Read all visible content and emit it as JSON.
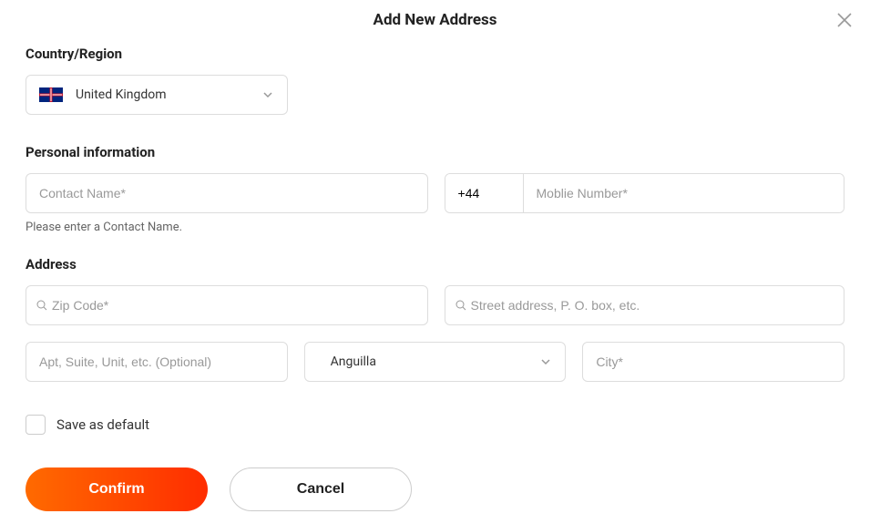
{
  "modal": {
    "title": "Add New Address"
  },
  "country": {
    "section_label": "Country/Region",
    "selected": "United Kingdom"
  },
  "personal": {
    "section_label": "Personal information",
    "contact_placeholder": "Contact Name*",
    "phone_code": "+44",
    "mobile_placeholder": "Moblie Number*",
    "helper": "Please enter a Contact Name."
  },
  "address": {
    "section_label": "Address",
    "zip_placeholder": "Zip Code*",
    "street_placeholder": "Street address, P. O. box, etc.",
    "apt_placeholder": "Apt, Suite, Unit, etc. (Optional)",
    "state_selected": "Anguilla",
    "city_placeholder": "City*"
  },
  "save_default_label": "Save as default",
  "buttons": {
    "confirm": "Confirm",
    "cancel": "Cancel"
  }
}
